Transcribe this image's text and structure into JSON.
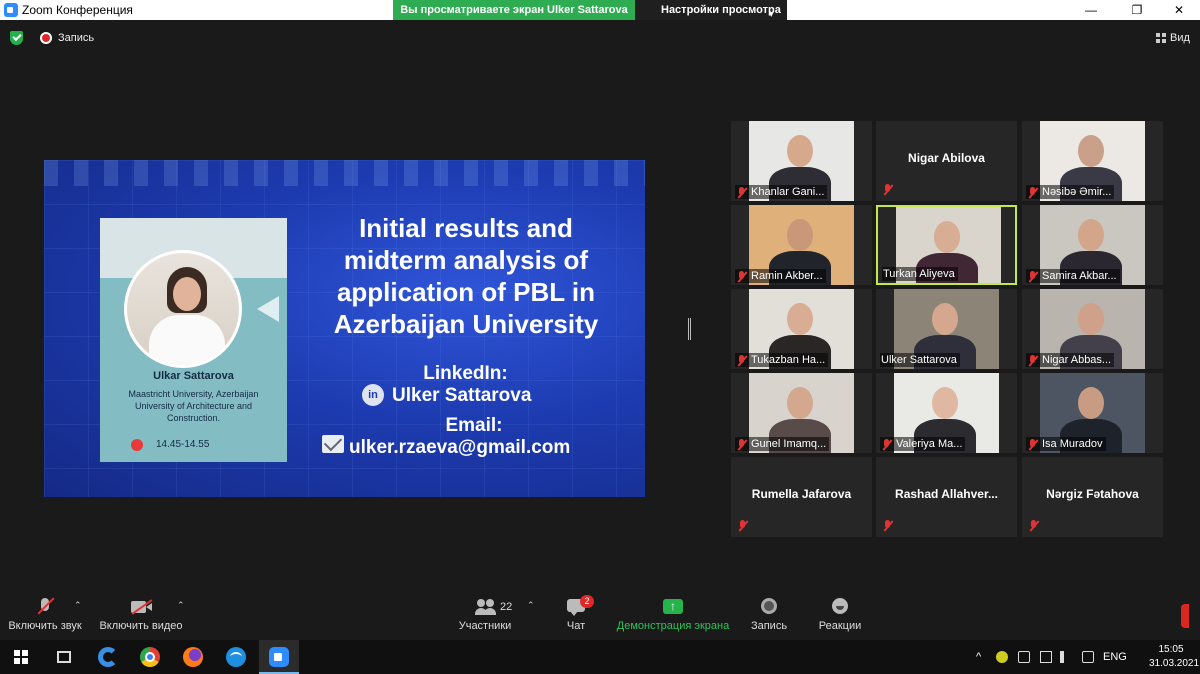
{
  "window": {
    "title": "Zoom Конференция",
    "share_banner": "Вы просматриваете экран Ulker Sattarova",
    "view_settings": "Настройки просмотра",
    "caret": "▾",
    "minimize": "—",
    "maximize": "❐",
    "close": "✕"
  },
  "meeting_bar": {
    "record_label": "Запись",
    "view_label": "Вид"
  },
  "slide": {
    "card_name": "Ulkar Sattarova",
    "card_affiliation": "Maastricht University, Azerbaijan University of Architecture and Construction.",
    "card_time": "14.45-14.55",
    "title": "Initial results and midterm analysis of application of PBL in Azerbaijan University",
    "linkedin_heading": "LinkedIn:",
    "linkedin_icon_text": "in",
    "linkedin_name": "Ulker Sattarova",
    "email_heading": "Email:",
    "email": "ulker.rzaeva@gmail.com"
  },
  "gallery": [
    {
      "label": "Khanlar Gani...",
      "has_video": true,
      "bg": "#e7e7e5",
      "skin": "#d7a98c",
      "clothes": "#2d2d33",
      "muted": true
    },
    {
      "label": "Nigar Abilova",
      "has_video": false,
      "muted": true
    },
    {
      "label": "Nəsibə Əmir...",
      "has_video": true,
      "bg": "#ece9e4",
      "skin": "#caa08a",
      "clothes": "#3a3a46",
      "muted": true
    },
    {
      "label": "Ramin Akber...",
      "has_video": true,
      "bg": "#dfb07a",
      "skin": "#c99879",
      "clothes": "#22242b",
      "muted": true
    },
    {
      "label": "Turkan Aliyeva",
      "has_video": true,
      "bg": "#d9d4cc",
      "skin": "#d7ad93",
      "clothes": "#402733",
      "muted": false,
      "active": true
    },
    {
      "label": "Samira Akbar...",
      "has_video": true,
      "bg": "#c9c7bf",
      "skin": "#d3a58b",
      "clothes": "#2a2730",
      "muted": true
    },
    {
      "label": "Tukazban Ha...",
      "has_video": true,
      "bg": "#e2ded8",
      "skin": "#d8ad94",
      "clothes": "#2b2626",
      "muted": true
    },
    {
      "label": "Ulker Sattarova",
      "has_video": true,
      "bg": "#8d8478",
      "skin": "#d5a78f",
      "clothes": "#2f2f3c",
      "muted": false
    },
    {
      "label": "Nigar Abbas...",
      "has_video": true,
      "bg": "#b9b4ad",
      "skin": "#cfa08a",
      "clothes": "#43404b",
      "muted": true
    },
    {
      "label": "Gunel Imamq...",
      "has_video": true,
      "bg": "#d8d3cd",
      "skin": "#d4a88f",
      "clothes": "#5a4b4b",
      "muted": true
    },
    {
      "label": "Valeriya Ma...",
      "has_video": true,
      "bg": "#e9e9e6",
      "skin": "#e0b8a2",
      "clothes": "#2b2b30",
      "muted": true
    },
    {
      "label": "Isa Muradov",
      "has_video": true,
      "bg": "#4d5462",
      "skin": "#c79c83",
      "clothes": "#1e222b",
      "muted": true
    },
    {
      "label": "Rumella Jafarova",
      "has_video": false,
      "muted": true
    },
    {
      "label": "Rashad  Allahver...",
      "has_video": false,
      "muted": true
    },
    {
      "label": "Nərgiz Fətahova",
      "has_video": false,
      "muted": true
    }
  ],
  "toolbar": {
    "unmute": "Включить звук",
    "start_video": "Включить видео",
    "participants": "Участники",
    "participants_count": "22",
    "chat": "Чат",
    "chat_badge": "2",
    "share_screen": "Демонстрация экрана",
    "record": "Запись",
    "reactions": "Реакции",
    "caret_up": "⌃"
  },
  "taskbar": {
    "tray_caret": "^",
    "language": "ENG",
    "time": "15:05",
    "date": "31.03.2021"
  }
}
